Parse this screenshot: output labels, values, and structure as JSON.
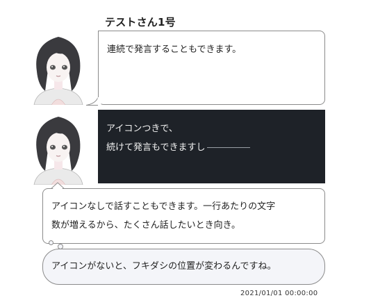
{
  "chat": {
    "speaker_name": "テストさん1号",
    "messages": [
      {
        "text": "連続で発言することもできます。",
        "style": "normal",
        "avatar": true
      },
      {
        "line1": "アイコンつきで、",
        "line2": "続けて発言もできますし",
        "style": "dark",
        "avatar": true
      },
      {
        "line1": "アイコンなしで話すこともできます。一行あたりの文字",
        "line2": "数が増えるから、たくさん話したいとき向き。",
        "style": "normal",
        "avatar": false
      },
      {
        "text": "アイコンがないと、フキダシの位置が変わるんですね。",
        "style": "thought",
        "avatar": false
      }
    ],
    "timestamp": "2021/01/01 00:00:00"
  },
  "colors": {
    "dark_bubble_bg": "#1e2228",
    "bubble_border": "#8a8a8a",
    "thought_bubble_bg": "#f4f5f9"
  },
  "icons": [
    "avatar-girl-icon",
    "avatar-girl-icon"
  ]
}
